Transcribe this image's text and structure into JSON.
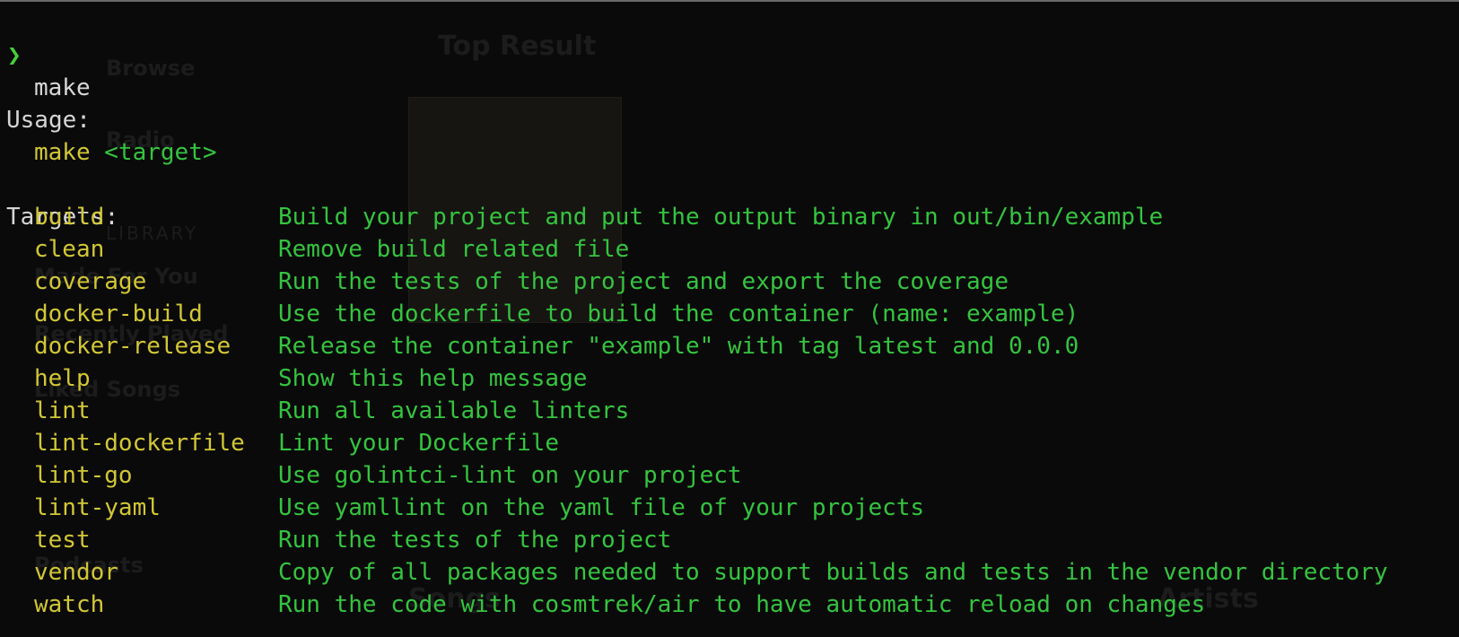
{
  "terminal": {
    "prompt_symbol": "❯",
    "command": "make",
    "usage_heading": "Usage:",
    "usage_cmd": "make",
    "usage_arg": "<target>",
    "targets_heading": "Targets:",
    "targets": [
      {
        "name": "build",
        "desc": "Build your project and put the output binary in out/bin/example"
      },
      {
        "name": "clean",
        "desc": "Remove build related file"
      },
      {
        "name": "coverage",
        "desc": "Run the tests of the project and export the coverage"
      },
      {
        "name": "docker-build",
        "desc": "Use the dockerfile to build the container (name: example)"
      },
      {
        "name": "docker-release",
        "desc": "Release the container \"example\" with tag latest and 0.0.0"
      },
      {
        "name": "help",
        "desc": "Show this help message"
      },
      {
        "name": "lint",
        "desc": "Run all available linters"
      },
      {
        "name": "lint-dockerfile",
        "desc": "Lint your Dockerfile"
      },
      {
        "name": "lint-go",
        "desc": "Use golintci-lint on your project"
      },
      {
        "name": "lint-yaml",
        "desc": "Use yamllint on the yaml file of your projects"
      },
      {
        "name": "test",
        "desc": "Run the tests of the project"
      },
      {
        "name": "vendor",
        "desc": "Copy of all packages needed to support builds and tests in the vendor directory"
      },
      {
        "name": "watch",
        "desc": "Run the code with cosmtrek/air to have automatic reload on changes"
      }
    ]
  },
  "background_app": {
    "top_result": "Top Result",
    "nav_browse": "Browse",
    "nav_radio": "Radio",
    "library_label": "LIBRARY",
    "made_for_you": "Made For You",
    "recently_played": "Recently Played",
    "liked_songs": "Liked Songs",
    "podcasts": "Podcasts",
    "songs": "Songs",
    "artists": "Artists"
  },
  "colors": {
    "background": "#0a0a0a",
    "prompt": "#44d13a",
    "target_name": "#d2c736",
    "description": "#35c43f",
    "text": "#d6d6d6"
  }
}
